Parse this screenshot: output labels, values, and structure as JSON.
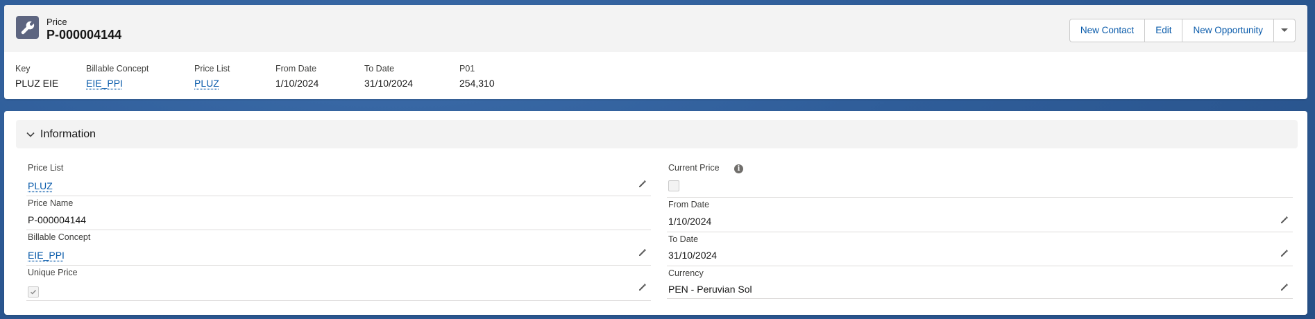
{
  "header": {
    "object_type": "Price",
    "record_title": "P-000004144",
    "actions": {
      "new_contact": "New Contact",
      "edit": "Edit",
      "new_opportunity": "New Opportunity"
    },
    "highlights": [
      {
        "label": "Key",
        "value": "PLUZ EIE"
      },
      {
        "label": "Billable Concept",
        "value": "EIE_PPI"
      },
      {
        "label": "Price List",
        "value": "PLUZ"
      },
      {
        "label": "From Date",
        "value": "1/10/2024"
      },
      {
        "label": "To Date",
        "value": "31/10/2024"
      },
      {
        "label": "P01",
        "value": "254,310"
      }
    ]
  },
  "section": {
    "title": "Information",
    "left": {
      "price_list": {
        "label": "Price List",
        "value": "PLUZ"
      },
      "price_name": {
        "label": "Price Name",
        "value": "P-000004144"
      },
      "billable_concept": {
        "label": "Billable Concept",
        "value": "EIE_PPI"
      },
      "unique_price": {
        "label": "Unique Price",
        "checked": true
      }
    },
    "right": {
      "current_price": {
        "label": "Current Price",
        "checked": false,
        "info_icon": "i"
      },
      "from_date": {
        "label": "From Date",
        "value": "1/10/2024"
      },
      "to_date": {
        "label": "To Date",
        "value": "31/10/2024"
      },
      "currency": {
        "label": "Currency",
        "value": "PEN - Peruvian Sol"
      }
    }
  }
}
